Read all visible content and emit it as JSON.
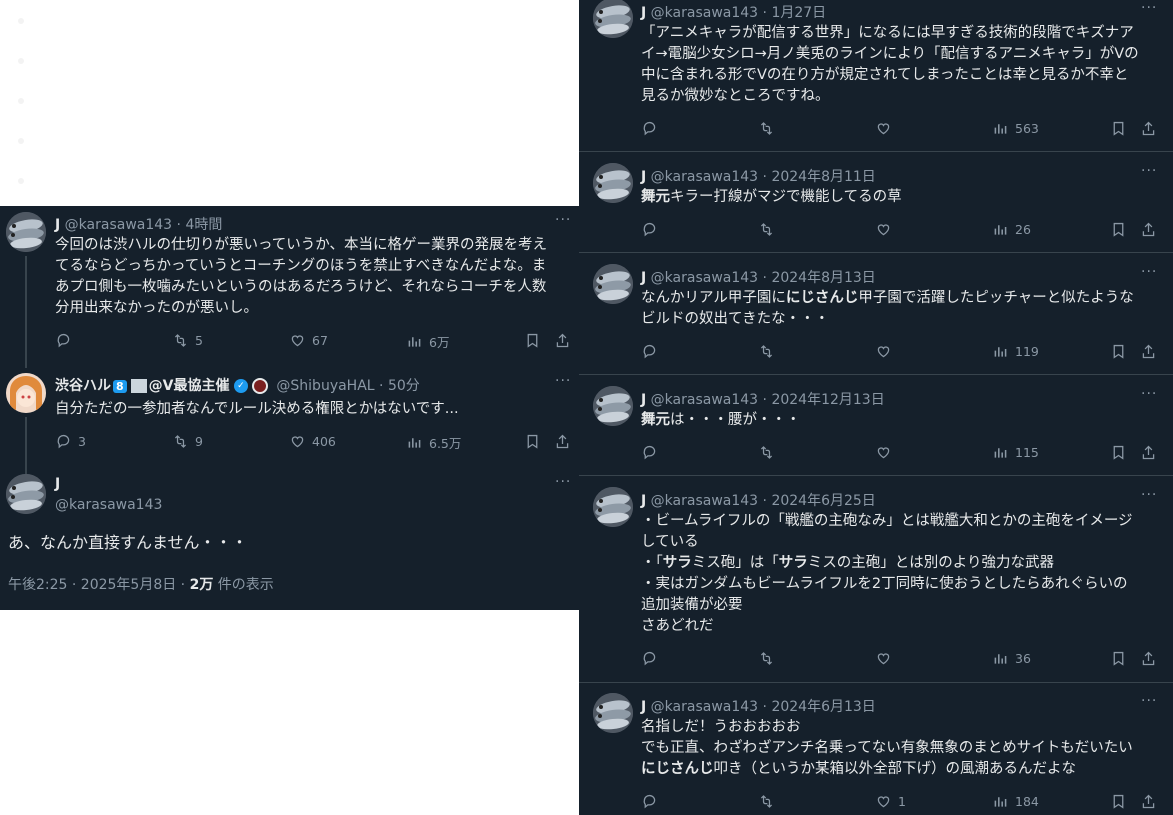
{
  "left": {
    "tweet1": {
      "name": "J",
      "handle": "@karasawa143",
      "time": "4時間",
      "lines": [
        "今回のは渋ハルの仕切りが悪いっていうか、本当に格ゲー業界の発展を考え",
        "てるならどっちかっていうとコーチングのほうを禁止すべきなんだよな。ま",
        "あプロ側も一枚噛みたいというのはあるだろうけど、それならコーチを人数",
        "分用出来なかったのが悪いし。"
      ],
      "retweets": "5",
      "likes": "67",
      "views": "6万"
    },
    "tweet2": {
      "name": "渋谷ハル",
      "badge_num": "8",
      "name_suffix": "@V最協主催",
      "handle": "@ShibuyaHAL",
      "time": "50分",
      "text": "自分ただの一参加者なんでルール決める権限とかはないです...",
      "replies": "3",
      "retweets": "9",
      "likes": "406",
      "views": "6.5万"
    },
    "main": {
      "name": "J",
      "handle": "@karasawa143",
      "text": "あ、なんか直接すんません・・・",
      "timestamp": "午後2:25 · 2025年5月8日 · ",
      "view_count": "2万",
      "view_label": " 件の表示"
    }
  },
  "right": {
    "tweets": [
      {
        "name": "J",
        "handle": "@karasawa143",
        "date": "1月27日",
        "lines": [
          "「アニメキャラが配信する世界」になるには早すぎる技術的段階でキズナア",
          "イ→電脳少女シロ→月ノ美兎のラインにより「配信するアニメキャラ」がVの",
          "中に含まれる形でVの在り方が規定されてしまったことは幸と見るか不幸と",
          "見るか微妙なところですね。"
        ],
        "views": "563"
      },
      {
        "name": "J",
        "handle": "@karasawa143",
        "date": "2024年8月11日",
        "bold": "舞元",
        "rest": "キラー打線がマジで機能してるの草",
        "views": "26"
      },
      {
        "name": "J",
        "handle": "@karasawa143",
        "date": "2024年8月13日",
        "line1_a": "なんかリアル甲子園に",
        "line1_bold": "にじさんじ",
        "line1_b": "甲子園で活躍したピッチャーと似たような",
        "line2": "ビルドの奴出てきたな・・・",
        "views": "119"
      },
      {
        "name": "J",
        "handle": "@karasawa143",
        "date": "2024年12月13日",
        "bold": "舞元",
        "rest": "は・・・腰が・・・",
        "views": "115"
      },
      {
        "name": "J",
        "handle": "@karasawa143",
        "date": "2024年6月25日",
        "line1": "・ビームライフルの「戦艦の主砲なみ」とは戦艦大和とかの主砲をイメージ",
        "line2": "している",
        "line3_a": "・「",
        "line3_b1": "サラ",
        "line3_c": "ミス砲」は「",
        "line3_b2": "サラ",
        "line3_d": "ミスの主砲」とは別のより強力な武器",
        "line4": "・実はガンダムもビームライフルを2丁同時に使おうとしたらあれぐらいの",
        "line5": "追加装備が必要",
        "line6": "さあどれだ",
        "views": "36"
      },
      {
        "name": "J",
        "handle": "@karasawa143",
        "date": "2024年6月13日",
        "line1": "名指しだ！うおおおおお",
        "line2": "でも正直、わざわざアンチ名乗ってない有象無象のまとめサイトもだいたい",
        "line3_bold": "にじさんじ",
        "line3_rest": "叩き（というか某箱以外全部下げ）の風潮あるんだよな",
        "likes": "1",
        "views": "184"
      }
    ]
  },
  "more_label": "···",
  "dot_sep": " · "
}
